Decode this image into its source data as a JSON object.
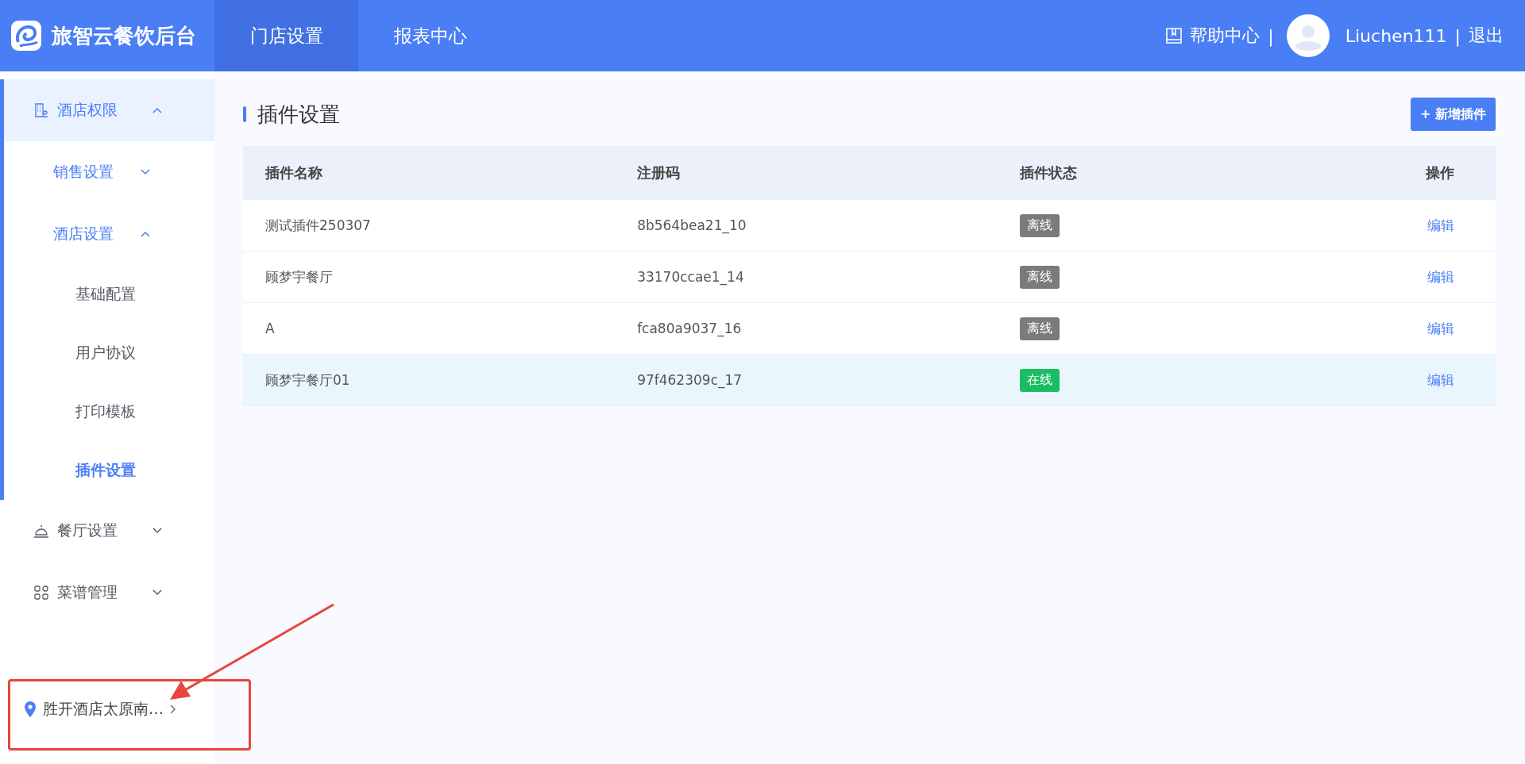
{
  "brand": {
    "title": "旅智云餐饮后台"
  },
  "nav": [
    {
      "label": "门店设置",
      "selected": true
    },
    {
      "label": "报表中心",
      "selected": false
    }
  ],
  "header_right": {
    "help": "帮助中心",
    "separator_1": "|",
    "username": "Liuchen111",
    "separator_2": "|",
    "logout": "退出"
  },
  "sidebar": {
    "items": [
      {
        "label": "酒店权限",
        "expanded": true,
        "selected": true,
        "children": [
          {
            "label": "销售设置",
            "expanded": false
          },
          {
            "label": "酒店设置",
            "expanded": true,
            "children": [
              {
                "label": "基础配置",
                "selected": false
              },
              {
                "label": "用户协议",
                "selected": false
              },
              {
                "label": "打印模板",
                "selected": false
              },
              {
                "label": "插件设置",
                "selected": true
              }
            ]
          }
        ]
      },
      {
        "label": "餐厅设置",
        "expanded": false,
        "selected": false
      },
      {
        "label": "菜谱管理",
        "expanded": false,
        "selected": false
      }
    ],
    "location": "胜开酒店太原南…"
  },
  "page": {
    "title": "插件设置",
    "add_button": "+ 新增插件"
  },
  "table": {
    "columns": [
      "插件名称",
      "注册码",
      "插件状态",
      "操作"
    ],
    "rows": [
      {
        "name": "测试插件250307",
        "code": "8b564bea21_10",
        "status": {
          "label": "离线",
          "online": false
        },
        "action": "编辑",
        "selected": false
      },
      {
        "name": "顾梦宇餐厅",
        "code": "33170ccae1_14",
        "status": {
          "label": "离线",
          "online": false
        },
        "action": "编辑",
        "selected": false
      },
      {
        "name": "A",
        "code": "fca80a9037_16",
        "status": {
          "label": "离线",
          "online": false
        },
        "action": "编辑",
        "selected": false
      },
      {
        "name": "顾梦宇餐厅01",
        "code": "97f462309c_17",
        "status": {
          "label": "在线",
          "online": true
        },
        "action": "编辑",
        "selected": true
      }
    ]
  }
}
